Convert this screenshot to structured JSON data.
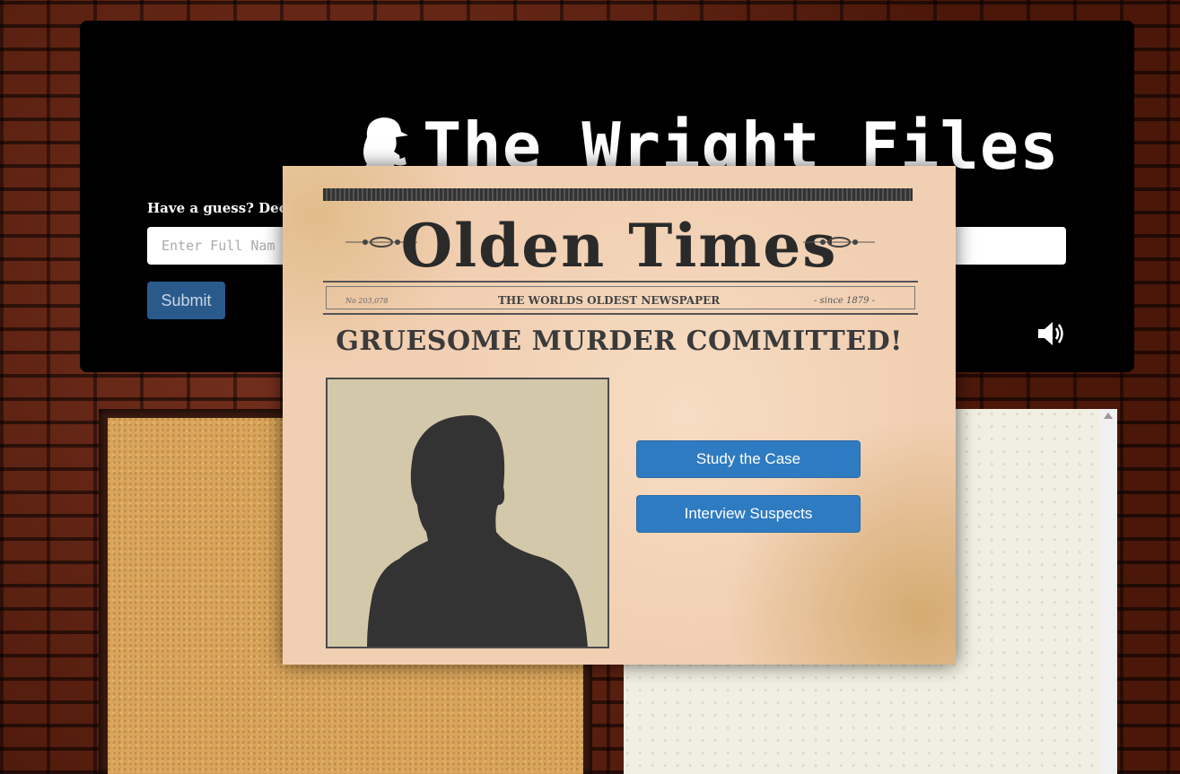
{
  "header": {
    "title": "The Wright Files",
    "guess_label": "Have a guess? Dec",
    "guess_placeholder": "Enter Full Nam",
    "submit_label": "Submit"
  },
  "newspaper": {
    "masthead": "Olden Times",
    "issue": "No 203,078",
    "tagline": "THE WORLDS OLDEST NEWSPAPER",
    "since": "- since 1879 -",
    "headline": "GRUESOME MURDER COMMITTED!",
    "buttons": {
      "study": "Study the Case",
      "interview": "Interview Suspects"
    }
  },
  "icons": {
    "logo": "sherlock-silhouette-icon",
    "sound": "speaker-volume-icon"
  },
  "colors": {
    "header_bg": "#000000",
    "button_blue": "#2f7bc1",
    "submit_blue": "#2a5a8c",
    "newspaper_bg": "#f1cfb2"
  }
}
